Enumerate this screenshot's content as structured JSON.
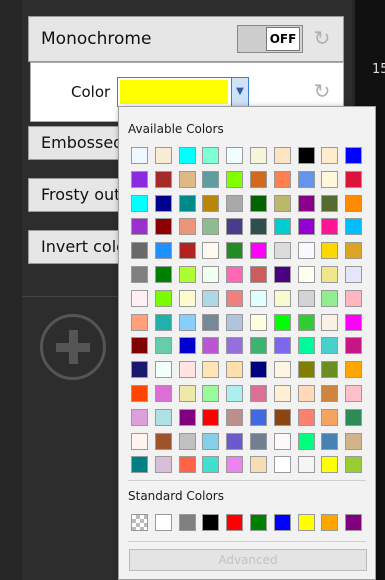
{
  "side_number": "15",
  "effects": {
    "monochrome": {
      "label": "Monochrome",
      "toggle_state": "OFF",
      "reset_icon": "reset-arrow-icon"
    },
    "color": {
      "label": "Color",
      "value": "#ffff00",
      "reset_icon": "reset-arrow-icon"
    },
    "emboss": {
      "label": "Embossed"
    },
    "frosty": {
      "label": "Frosty outline"
    },
    "invert": {
      "label": "Invert colors"
    }
  },
  "add_button": {
    "icon": "plus-icon"
  },
  "color_picker": {
    "available_header": "Available Colors",
    "standard_header": "Standard Colors",
    "advanced_label": "Advanced",
    "available_colors": [
      [
        "#f0f8ff",
        "#faebd7",
        "#00ffff",
        "#7fffd4",
        "#f0ffff",
        "#f5f5dc",
        "#ffe4c4",
        "#000000",
        "#ffebcd",
        "#0000ff"
      ],
      [
        "#8a2be2",
        "#a52a2a",
        "#deb887",
        "#5f9ea0",
        "#7fff00",
        "#d2691e",
        "#ff7f50",
        "#6495ed",
        "#fff8dc",
        "#dc143c"
      ],
      [
        "#00ffff",
        "#00008b",
        "#008b8b",
        "#b8860b",
        "#a9a9a9",
        "#006400",
        "#bdb76b",
        "#8b008b",
        "#556b2f",
        "#ff8c00"
      ],
      [
        "#9932cc",
        "#8b0000",
        "#e9967a",
        "#8fbc8f",
        "#483d8b",
        "#2f4f4f",
        "#00ced1",
        "#9400d3",
        "#ff1493",
        "#00bfff"
      ],
      [
        "#696969",
        "#1e90ff",
        "#b22222",
        "#fffaf0",
        "#228b22",
        "#ff00ff",
        "#dcdcdc",
        "#f8f8ff",
        "#ffd700",
        "#daa520"
      ],
      [
        "#808080",
        "#008000",
        "#adff2f",
        "#f0fff0",
        "#ff69b4",
        "#cd5c5c",
        "#4b0082",
        "#fffff0",
        "#f0e68c",
        "#e6e6fa"
      ],
      [
        "#fff0f5",
        "#7cfc00",
        "#fffacd",
        "#add8e6",
        "#f08080",
        "#e0ffff",
        "#fafad2",
        "#d3d3d3",
        "#90ee90",
        "#ffb6c1"
      ],
      [
        "#ffa07a",
        "#20b2aa",
        "#87cefa",
        "#778899",
        "#b0c4de",
        "#ffffe0",
        "#00ff00",
        "#32cd32",
        "#faf0e6",
        "#ff00ff"
      ],
      [
        "#800000",
        "#66cdaa",
        "#0000cd",
        "#ba55d3",
        "#9370db",
        "#3cb371",
        "#7b68ee",
        "#00fa9a",
        "#48d1cc",
        "#c71585"
      ],
      [
        "#191970",
        "#f5fffa",
        "#ffe4e1",
        "#ffe4b5",
        "#ffdead",
        "#000080",
        "#fdf5e6",
        "#808000",
        "#6b8e23",
        "#ffa500"
      ],
      [
        "#ff4500",
        "#da70d6",
        "#eee8aa",
        "#98fb98",
        "#afeeee",
        "#db7093",
        "#ffefd5",
        "#ffdab9",
        "#cd853f",
        "#ffc0cb"
      ],
      [
        "#dda0dd",
        "#b0e0e6",
        "#800080",
        "#ff0000",
        "#bc8f8f",
        "#4169e1",
        "#8b4513",
        "#fa8072",
        "#f4a460",
        "#2e8b57"
      ],
      [
        "#fff5ee",
        "#a0522d",
        "#c0c0c0",
        "#87ceeb",
        "#6a5acd",
        "#708090",
        "#fffafa",
        "#00ff7f",
        "#4682b4",
        "#d2b48c"
      ],
      [
        "#008080",
        "#d8bfd8",
        "#ff6347",
        "#40e0d0",
        "#ee82ee",
        "#f5deb3",
        "#ffffff",
        "#f5f5f5",
        "#ffff00",
        "#9acd32"
      ]
    ],
    "standard_colors": [
      "transparent",
      "#ffffff",
      "#808080",
      "#000000",
      "#ff0000",
      "#008000",
      "#0000ff",
      "#ffff00",
      "#ffa500",
      "#800080"
    ]
  }
}
